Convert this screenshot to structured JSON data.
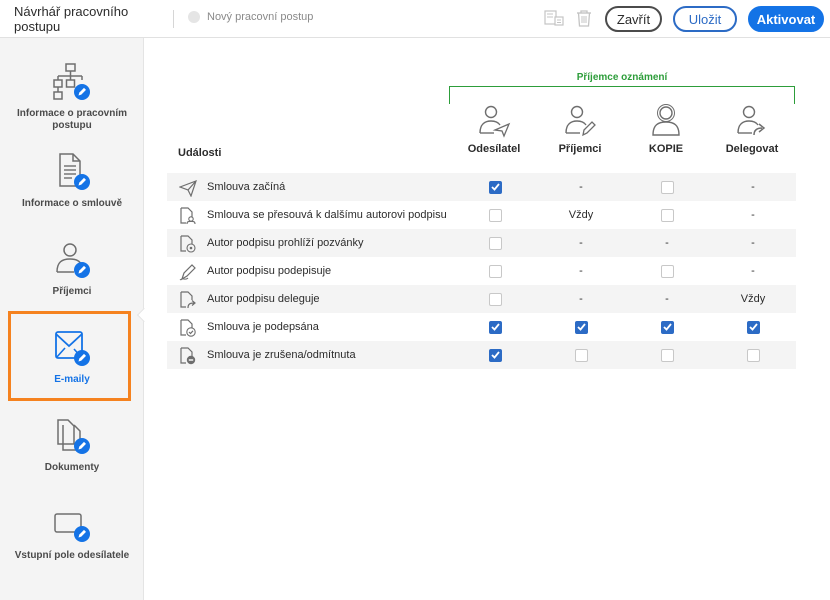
{
  "header": {
    "title": "Návrhář pracovního postupu",
    "workflow_name": "Nový pracovní postup",
    "close_label": "Zavřít",
    "save_label": "Uložit",
    "activate_label": "Aktivovat"
  },
  "sidebar": {
    "items": [
      {
        "label": "Informace o pracovním postupu",
        "icon": "workflow-hierarchy-icon"
      },
      {
        "label": "Informace o smlouvě",
        "icon": "agreement-document-icon"
      },
      {
        "label": "Příjemci",
        "icon": "recipient-person-icon"
      },
      {
        "label": "E-maily",
        "icon": "email-envelope-icon",
        "active": true
      },
      {
        "label": "Dokumenty",
        "icon": "documents-stack-icon"
      },
      {
        "label": "Vstupní pole odesílatele",
        "icon": "input-field-icon"
      }
    ]
  },
  "notifications": {
    "group_label": "Příjemce oznámení",
    "events_label": "Události",
    "columns": [
      {
        "label": "Odesílatel",
        "icon": "sender-icon"
      },
      {
        "label": "Příjemci",
        "icon": "recipient-icon"
      },
      {
        "label": "KOPIE",
        "icon": "cc-icon"
      },
      {
        "label": "Delegovat",
        "icon": "delegate-icon"
      }
    ],
    "rows": [
      {
        "label": "Smlouva začíná",
        "icon": "send-plane-icon",
        "cells": [
          "on",
          "-",
          "off",
          "-"
        ]
      },
      {
        "label": "Smlouva se přesouvá k dalšímu autorovi podpisu",
        "icon": "next-signer-icon",
        "cells": [
          "off",
          "Vždy",
          "off",
          "-"
        ]
      },
      {
        "label": "Autor podpisu prohlíží pozvánky",
        "icon": "view-invite-icon",
        "cells": [
          "off",
          "-",
          "-",
          "-"
        ]
      },
      {
        "label": "Autor podpisu podepisuje",
        "icon": "signing-pen-icon",
        "cells": [
          "off",
          "-",
          "off",
          "-"
        ]
      },
      {
        "label": "Autor podpisu deleguje",
        "icon": "delegate-doc-icon",
        "cells": [
          "off",
          "-",
          "-",
          "Vždy"
        ]
      },
      {
        "label": "Smlouva je podepsána",
        "icon": "signed-check-icon",
        "cells": [
          "on",
          "on",
          "on",
          "on"
        ]
      },
      {
        "label": "Smlouva je zrušena/odmítnuta",
        "icon": "cancelled-doc-icon",
        "cells": [
          "on",
          "off",
          "off",
          "off"
        ]
      }
    ]
  },
  "colors": {
    "accent": "#1473e6",
    "checkbox": "#2c6bc5",
    "group_green": "#2d9d3a",
    "active_outline": "#f5821f"
  }
}
